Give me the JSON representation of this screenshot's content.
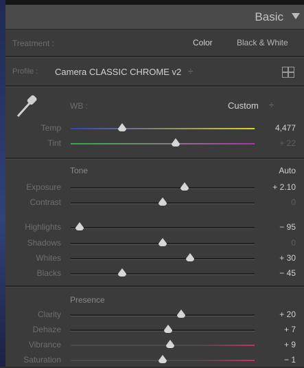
{
  "panel": {
    "title": "Basic"
  },
  "treatment": {
    "label": "Treatment :",
    "options": [
      "Color",
      "Black & White"
    ]
  },
  "profile": {
    "label": "Profile :",
    "value": "Camera CLASSIC CHROME v2",
    "caret": "÷"
  },
  "wb": {
    "label": "WB :",
    "value": "Custom",
    "caret": "÷"
  },
  "temp": {
    "label": "Temp",
    "value": "4,477",
    "position": 0.28
  },
  "tint": {
    "label": "Tint",
    "value": "+ 22",
    "position": 0.57
  },
  "tone": {
    "title": "Tone",
    "auto": "Auto"
  },
  "exposure": {
    "label": "Exposure",
    "value": "+ 2.10",
    "position": 0.62
  },
  "contrast": {
    "label": "Contrast",
    "value": "0",
    "position": 0.5
  },
  "highlights": {
    "label": "Highlights",
    "value": "− 95",
    "position": 0.05
  },
  "shadows": {
    "label": "Shadows",
    "value": "0",
    "position": 0.5
  },
  "whites": {
    "label": "Whites",
    "value": "+ 30",
    "position": 0.65
  },
  "blacks": {
    "label": "Blacks",
    "value": "− 45",
    "position": 0.28
  },
  "presence": {
    "title": "Presence"
  },
  "clarity": {
    "label": "Clarity",
    "value": "+ 20",
    "position": 0.6
  },
  "dehaze": {
    "label": "Dehaze",
    "value": "+ 7",
    "position": 0.53
  },
  "vibrance": {
    "label": "Vibrance",
    "value": "+ 9",
    "position": 0.54
  },
  "saturation": {
    "label": "Saturation",
    "value": "− 1",
    "position": 0.5
  },
  "colors": {
    "temp_track": [
      "#3340c8",
      "#d8d820"
    ],
    "tint_track": [
      "#30b040",
      "#b030b0"
    ],
    "vibrance_track": [
      "#4a4a4a",
      "#c83060"
    ]
  }
}
